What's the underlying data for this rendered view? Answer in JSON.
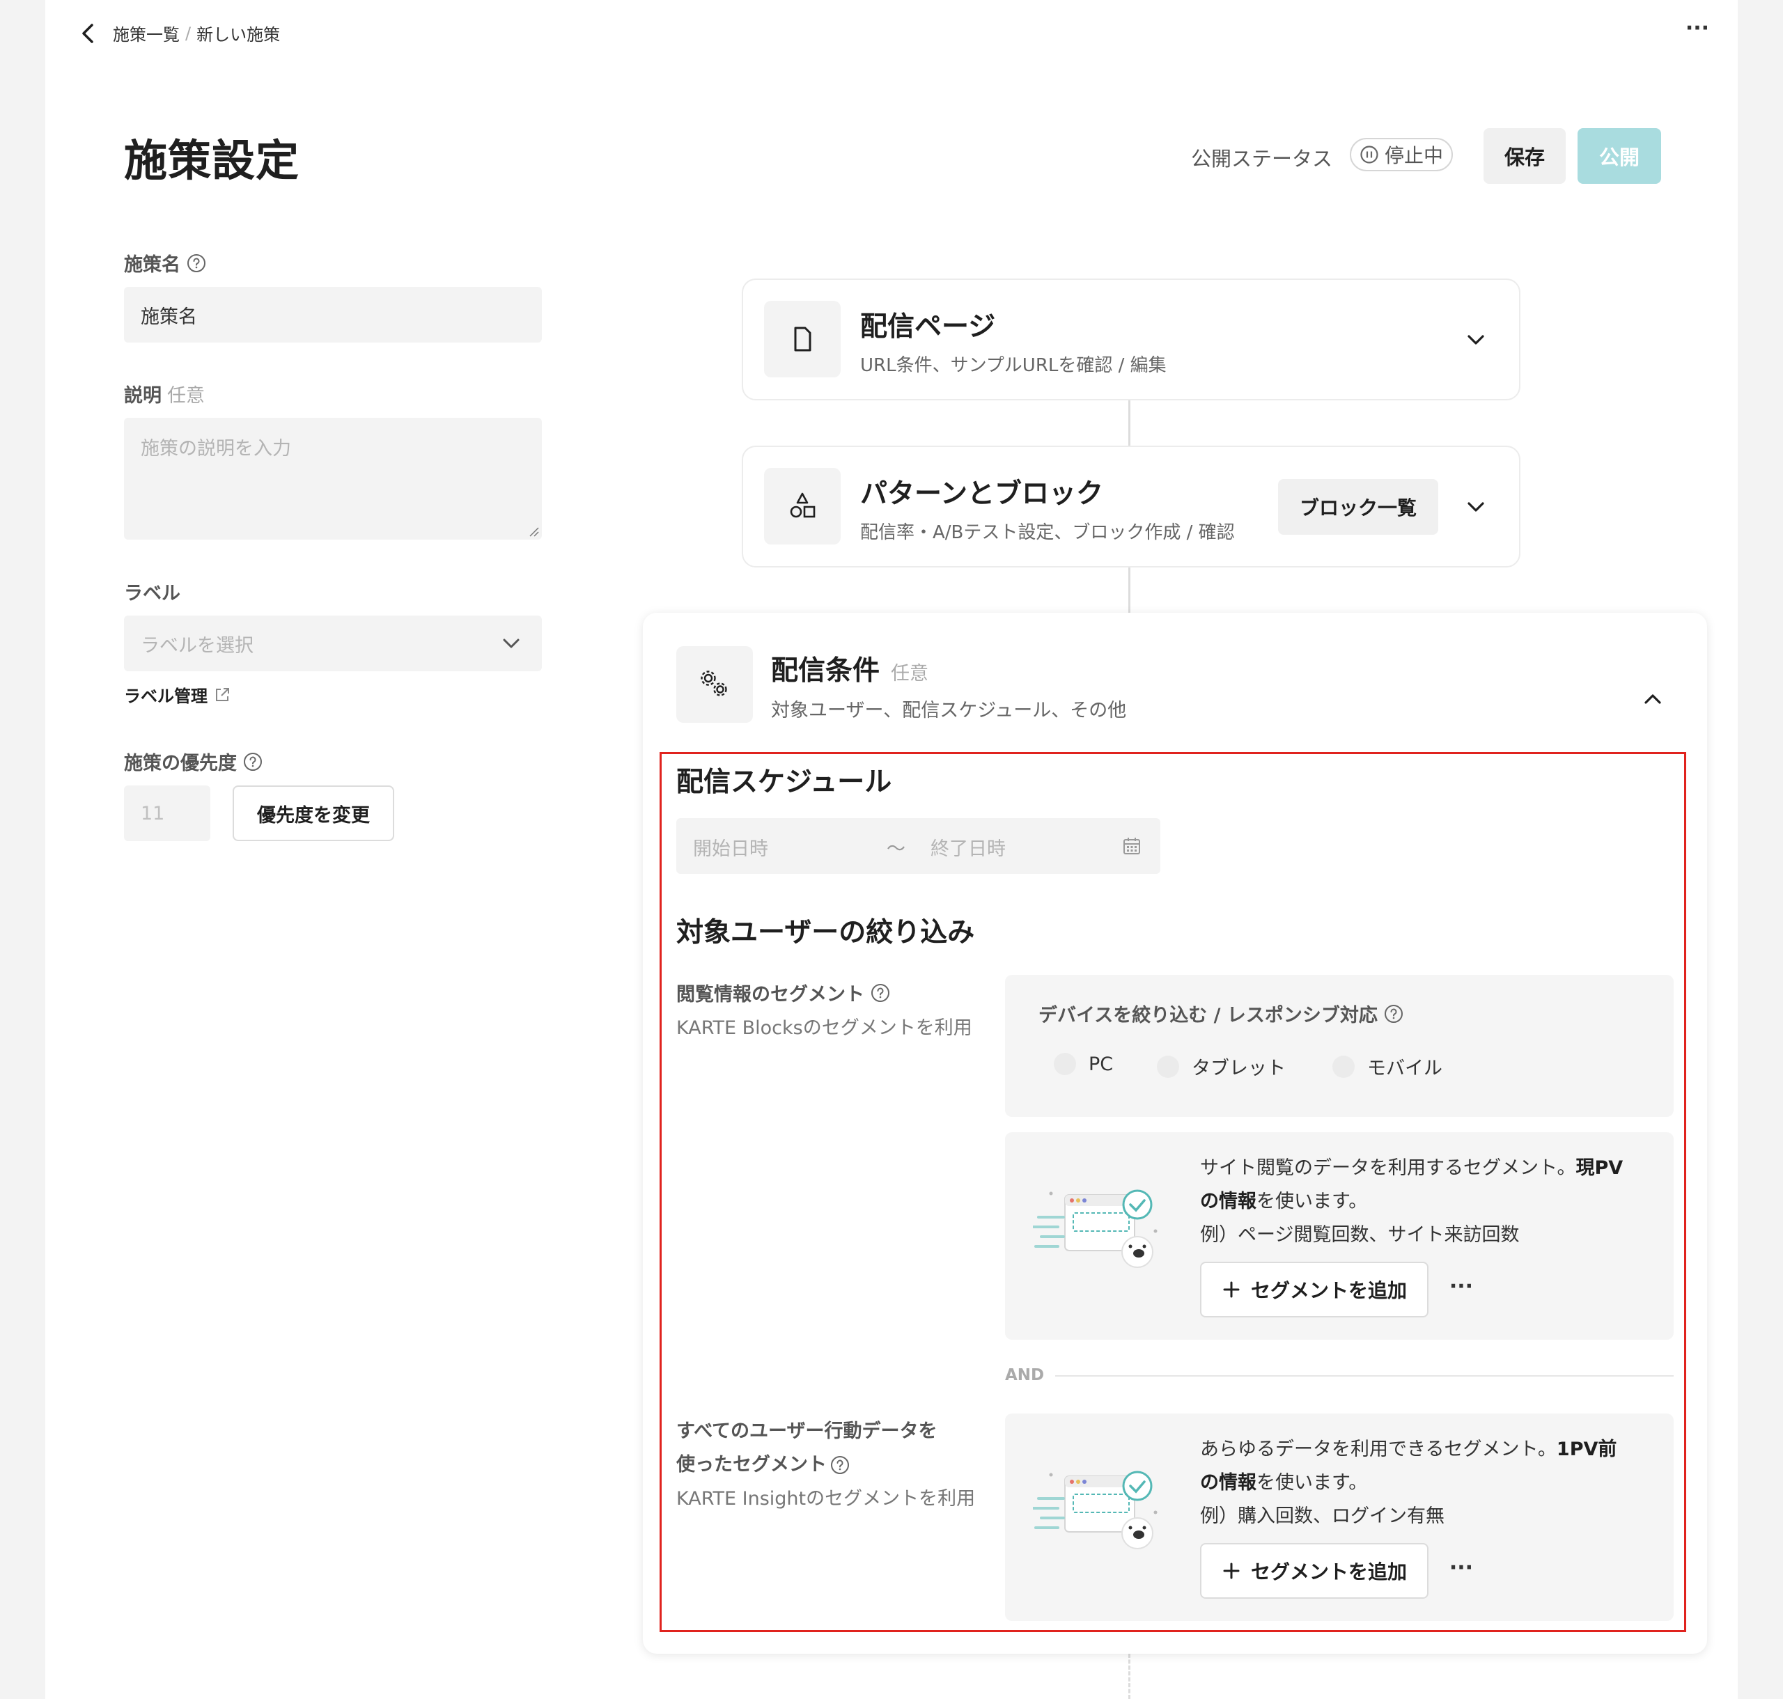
{
  "header": {
    "breadcrumb": [
      "施策一覧",
      "新しい施策"
    ],
    "breadcrumb_sep": "/",
    "more": "···"
  },
  "title": "施策設定",
  "status": {
    "label": "公開ステータス",
    "badge": "停止中",
    "save_label": "保存",
    "publish_label": "公開",
    "accent": "#a9dcdf"
  },
  "form": {
    "name_label": "施策名",
    "name_value": "施策名",
    "desc_label": "説明",
    "desc_optional": "任意",
    "desc_placeholder": "施策の説明を入力",
    "label_label": "ラベル",
    "label_placeholder": "ラベルを選択",
    "label_manage": "ラベル管理",
    "priority_label": "施策の優先度",
    "priority_value": "11",
    "priority_button": "優先度を変更"
  },
  "cards": {
    "page": {
      "title": "配信ページ",
      "sub": "URL条件、サンプルURLを確認 / 編集",
      "icon": "document-icon"
    },
    "pattern": {
      "title": "パターンとブロック",
      "sub": "配信率・A/Bテスト設定、ブロック作成 / 確認",
      "button": "ブロック一覧",
      "icon": "shapes-icon"
    },
    "condition": {
      "title": "配信条件",
      "optional": "任意",
      "sub": "対象ユーザー、配信スケジュール、その他",
      "icon": "gears-icon"
    }
  },
  "schedule": {
    "title": "配信スケジュール",
    "start_placeholder": "開始日時",
    "tilde": "〜",
    "end_placeholder": "終了日時"
  },
  "targeting": {
    "title": "対象ユーザーの絞り込み",
    "browse": {
      "label": "閲覧情報のセグメント",
      "sub": "KARTE Blocksのセグメントを利用",
      "device_title": "デバイスを絞り込む / レスポンシブ対応",
      "devices": [
        "PC",
        "タブレット",
        "モバイル"
      ],
      "text_1": "サイト閲覧のデータを利用するセグメント。",
      "text_1_bold_a": "現PV",
      "text_1_bold_b": "の情報",
      "text_1_tail": "を使います。",
      "text_2": "例）ページ閲覧回数、サイト来訪回数",
      "add_label": "セグメントを追加"
    },
    "and": "AND",
    "insight": {
      "label_1": "すべてのユーザー行動データを",
      "label_2": "使ったセグメント",
      "sub": "KARTE Insightのセグメントを利用",
      "text_1": "あらゆるデータを利用できるセグメント。",
      "text_1_bold_a": "1PV前",
      "text_1_bold_b": "の情報",
      "text_1_tail": "を使います。",
      "text_2": "例）購入回数、ログイン有無",
      "add_label": "セグメントを追加"
    },
    "more": "···"
  }
}
